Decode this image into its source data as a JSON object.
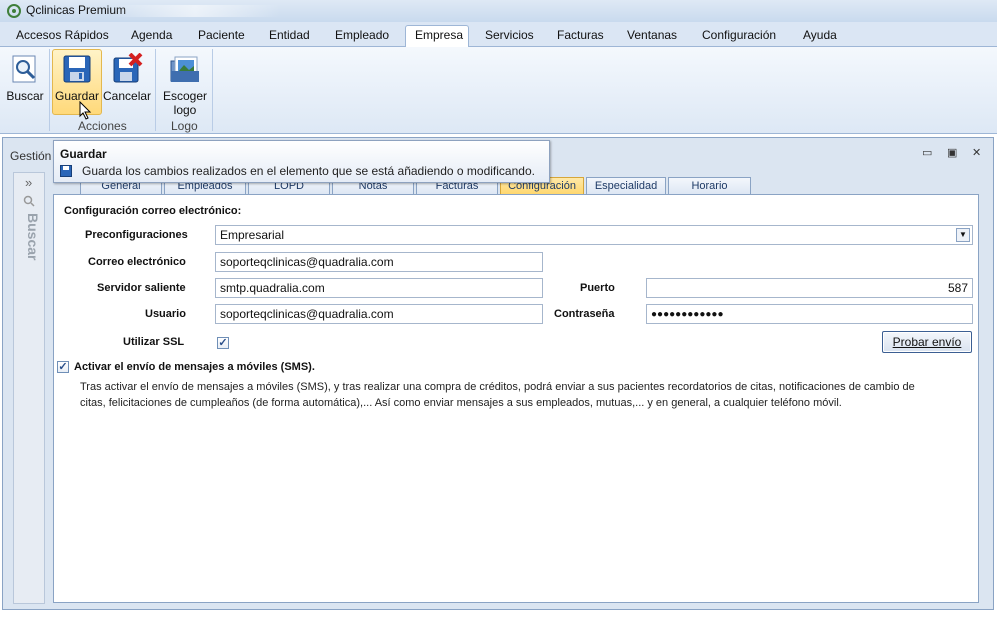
{
  "app": {
    "title": "Qclinicas Premium"
  },
  "menu": [
    "Accesos Rápidos",
    "Agenda",
    "Paciente",
    "Entidad",
    "Empleado",
    "Empresa",
    "Servicios",
    "Facturas",
    "Ventanas",
    "Configuración",
    "Ayuda"
  ],
  "ribbon": {
    "buscar": "Buscar",
    "guardar": "Guardar",
    "cancelar": "Cancelar",
    "escoger_line1": "Escoger",
    "escoger_line2": "logo",
    "group_acciones": "Acciones",
    "group_logo": "Logo"
  },
  "tooltip": {
    "title": "Guardar",
    "text": "Guarda los cambios realizados en el elemento que se está añadiendo o modificando."
  },
  "panel": {
    "gestion": "Gestión",
    "sidebar_label": "Buscar",
    "sidebar_arrows": "»"
  },
  "window_controls": {
    "minimize": "▭",
    "restore": "▣",
    "close": "✕"
  },
  "tabs": [
    "General",
    "Empleados",
    "LOPD",
    "Notas",
    "Facturas",
    "Configuración",
    "Especialidad",
    "Horario"
  ],
  "active_tab": "Configuración",
  "form": {
    "section_title": "Configuración correo electrónico:",
    "preconfig_label": "Preconfiguraciones",
    "preconfig_value": "Empresarial",
    "email_label": "Correo electrónico",
    "email_value": "soporteqclinicas@quadralia.com",
    "server_label": "Servidor saliente",
    "server_value": "smtp.quadralia.com",
    "port_label": "Puerto",
    "port_value": "587",
    "user_label": "Usuario",
    "user_value": "soporteqclinicas@quadralia.com",
    "password_label": "Contraseña",
    "password_value": "●●●●●●●●●●●●",
    "ssl_label": "Utilizar SSL",
    "ssl_checked": true,
    "test_button": "Probar envío",
    "sms_label": "Activar el envío de mensajes a móviles (SMS).",
    "sms_checked": true,
    "sms_text_1": "Tras activar el envío de mensajes a móviles (SMS), y tras realizar una compra de créditos, podrá enviar a sus pacientes recordatorios de citas, notificaciones de cambio de",
    "sms_text_2": "citas, felicitaciones de cumpleaños (de forma automática),... Así como enviar mensajes a sus empleados, mutuas,... y en general, a cualquier teléfono móvil."
  }
}
